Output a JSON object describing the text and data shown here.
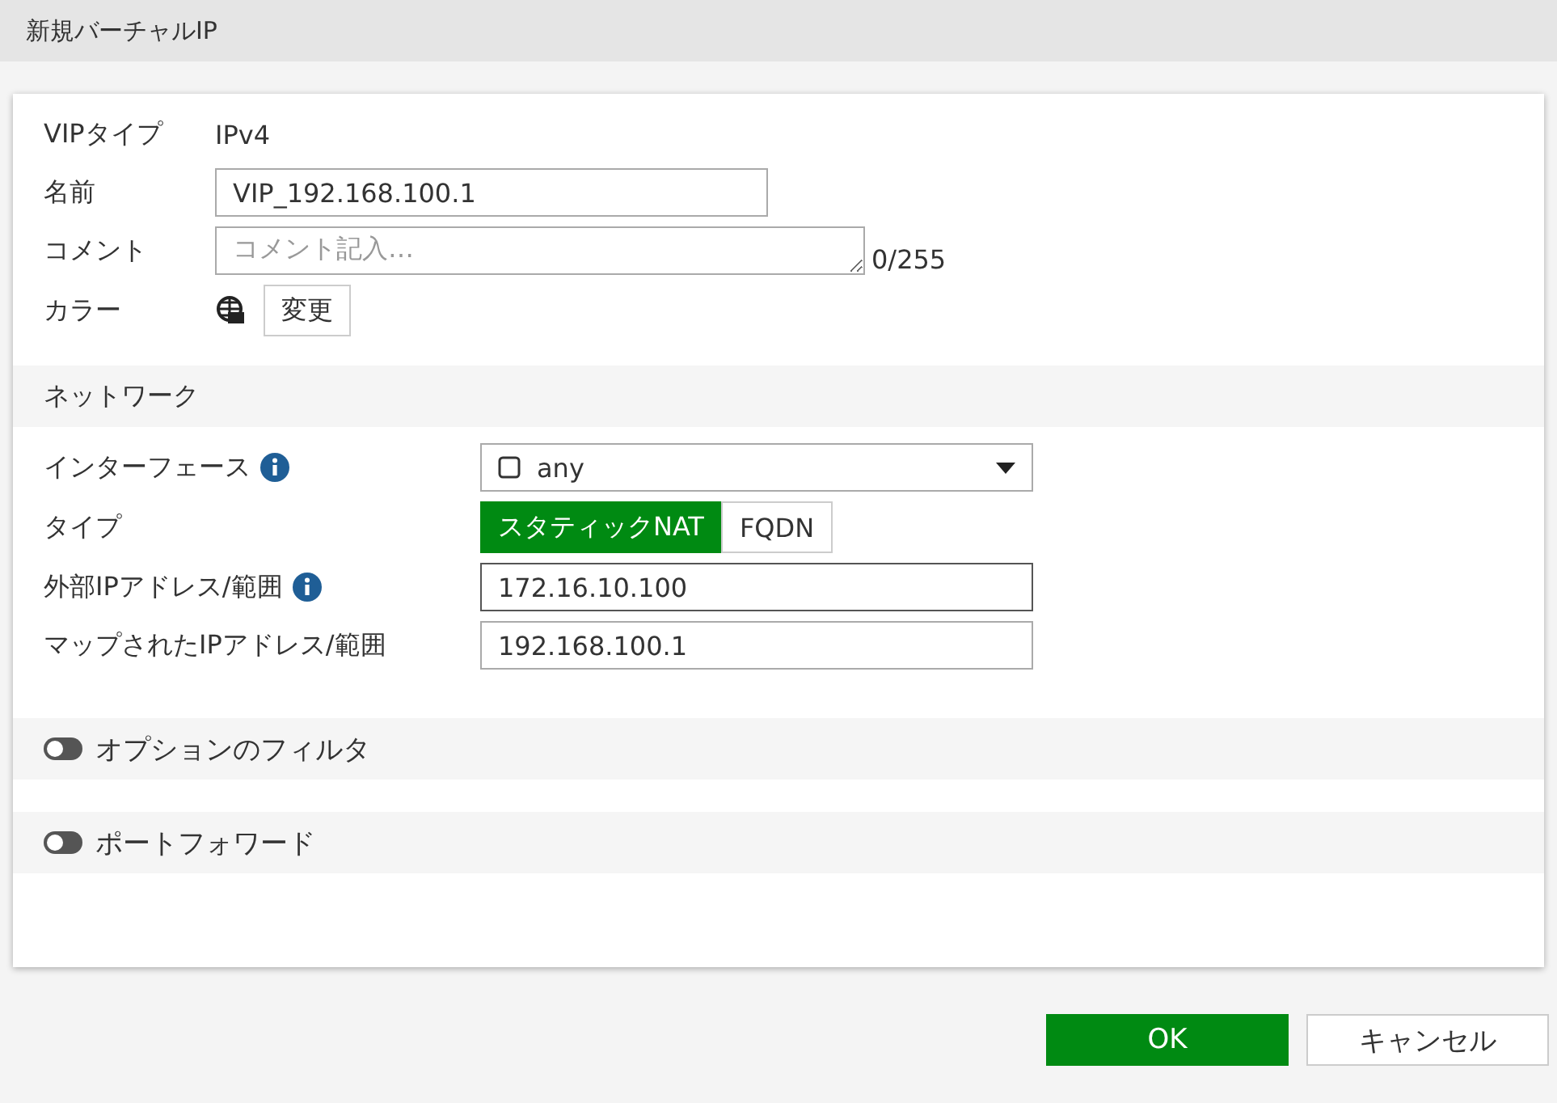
{
  "window": {
    "title": "新規バーチャルIP"
  },
  "general": {
    "vip_type": {
      "label": "VIPタイプ",
      "value": "IPv4"
    },
    "name": {
      "label": "名前",
      "value": "VIP_192.168.100.1"
    },
    "comment": {
      "label": "コメント",
      "placeholder": "コメント記入…",
      "count": "0/255"
    },
    "color": {
      "label": "カラー",
      "button": "変更"
    }
  },
  "network": {
    "title": "ネットワーク",
    "interface": {
      "label": "インターフェース",
      "info": true,
      "value": "any"
    },
    "type": {
      "label": "タイプ",
      "options": [
        {
          "label": "スタティックNAT",
          "selected": true
        },
        {
          "label": "FQDN",
          "selected": false
        }
      ]
    },
    "external": {
      "label": "外部IPアドレス/範囲",
      "info": true,
      "value": "172.16.10.100"
    },
    "mapped": {
      "label": "マップされたIPアドレス/範囲",
      "info": false,
      "value": "192.168.100.1"
    }
  },
  "toggles": [
    {
      "label": "オプションのフィルタ",
      "on": false
    },
    {
      "label": "ポートフォワード",
      "on": false
    }
  ],
  "buttons": [
    {
      "label": "OK",
      "kind": "primary"
    },
    {
      "label": "キャンセル",
      "kind": "secondary"
    }
  ]
}
